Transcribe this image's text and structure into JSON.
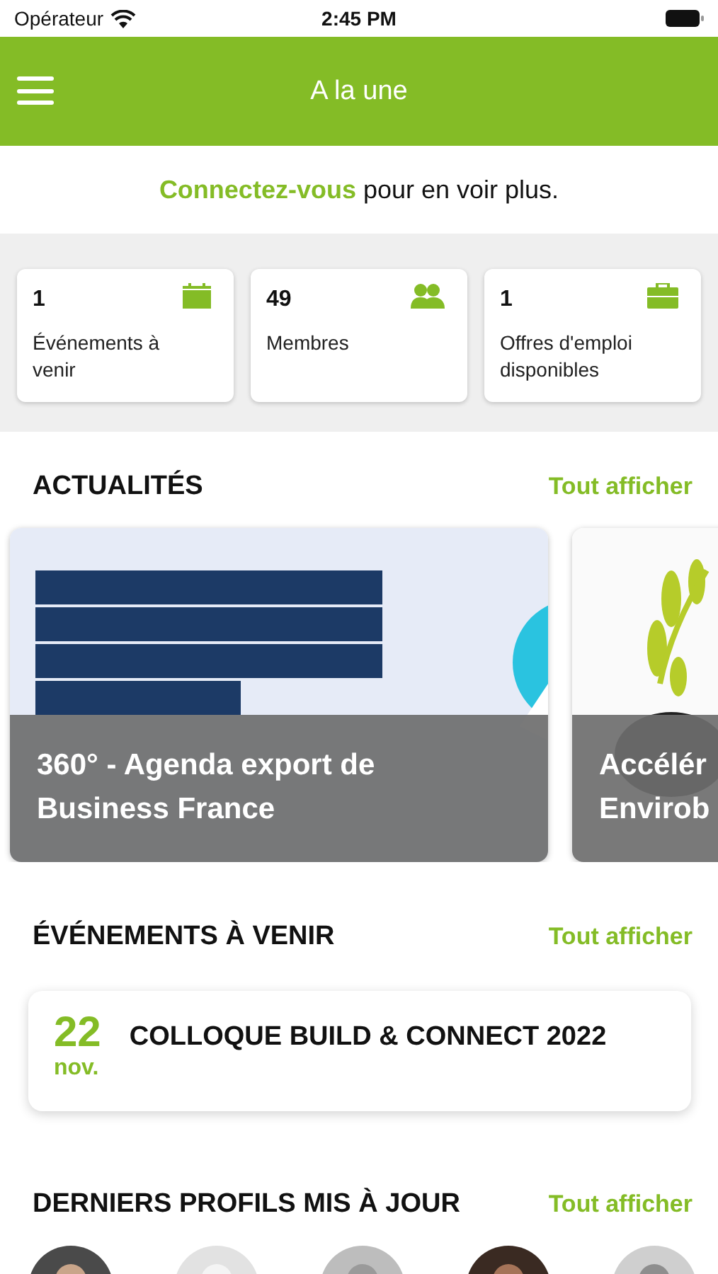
{
  "status_bar": {
    "carrier": "Opérateur",
    "time": "2:45 PM"
  },
  "header": {
    "title": "A la une"
  },
  "login_prompt": {
    "link": "Connectez-vous",
    "text": "pour en voir plus."
  },
  "stats": [
    {
      "kind": "events",
      "value": "1",
      "label": "Événements à venir"
    },
    {
      "kind": "members",
      "value": "49",
      "label": "Membres"
    },
    {
      "kind": "jobs",
      "value": "1",
      "label": "Offres d'emploi disponibles"
    }
  ],
  "news": {
    "title": "ACTUALITÉS",
    "see_all": "Tout afficher",
    "items": [
      {
        "kind": "picture",
        "caption_lines": [
          "360° - Agenda export de",
          "Business France"
        ]
      },
      {
        "kind": "picture",
        "caption_lines": [
          "Accélér",
          "Envirob"
        ]
      }
    ]
  },
  "events": {
    "title": "ÉVÉNEMENTS À VENIR",
    "see_all": "Tout afficher",
    "items": [
      {
        "day": "22",
        "month": "nov.",
        "name": "COLLOQUE BUILD & CONNECT 2022"
      }
    ]
  },
  "profiles": {
    "title": "DERNIERS PROFILS MIS À JOUR",
    "see_all": "Tout afficher"
  }
}
